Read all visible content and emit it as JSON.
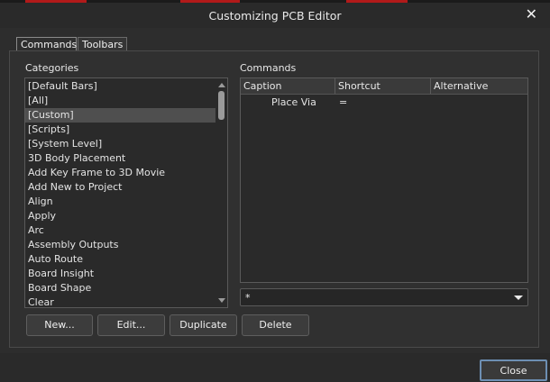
{
  "window": {
    "title": "Customizing PCB Editor",
    "close_glyph": "✕"
  },
  "tabs": [
    {
      "label": "Commands",
      "active": true
    },
    {
      "label": "Toolbars",
      "active": false
    }
  ],
  "categories": {
    "label": "Categories",
    "selected": "[Custom]",
    "items": [
      "[Default Bars]",
      "[All]",
      "[Custom]",
      "[Scripts]",
      "[System Level]",
      "3D Body Placement",
      "Add Key Frame to 3D Movie",
      "Add New to Project",
      "Align",
      "Apply",
      "Arc",
      "Assembly Outputs",
      "Auto Route",
      "Board Insight",
      "Board Shape",
      "Clear"
    ]
  },
  "commands": {
    "label": "Commands",
    "columns": [
      "Caption",
      "Shortcut",
      "Alternative"
    ],
    "rows": [
      {
        "caption": "Place Via",
        "shortcut": "=",
        "alternative": ""
      }
    ],
    "filter_value": "*"
  },
  "buttons": {
    "new": "New...",
    "edit": "Edit...",
    "duplicate": "Duplicate",
    "delete": "Delete",
    "close": "Close"
  },
  "colors": {
    "background": "#2d2d2d",
    "selection": "#4f4f4f",
    "close_border": "#6d8fb3",
    "top_accent": "#b11a1a"
  }
}
